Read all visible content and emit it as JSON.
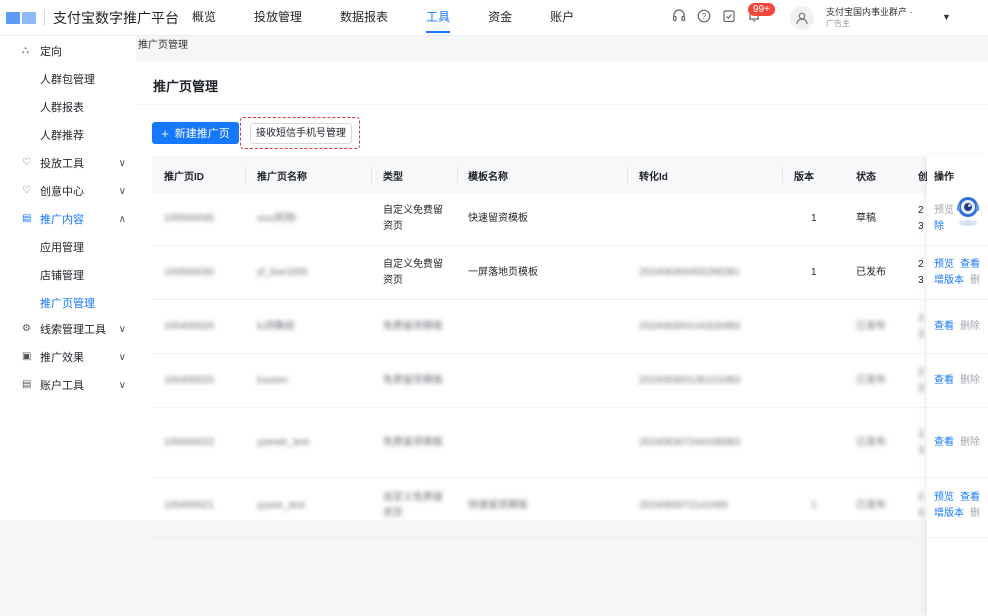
{
  "app": {
    "title": "支付宝数字推广平台"
  },
  "nav": [
    {
      "label": "概览",
      "active": false
    },
    {
      "label": "投放管理",
      "active": false
    },
    {
      "label": "数据报表",
      "active": false
    },
    {
      "label": "工具",
      "active": true
    },
    {
      "label": "资金",
      "active": false
    },
    {
      "label": "账户",
      "active": false
    }
  ],
  "topbar": {
    "icons": [
      "headset-icon",
      "help-icon",
      "todo-icon",
      "bell-icon"
    ],
    "badge": "99+",
    "user_name": "支付宝国内事业群产 ·",
    "user_role": "广告主"
  },
  "sidebar": {
    "items": [
      {
        "label": "定向",
        "icon": "target-icon",
        "type": "group",
        "expanded": true
      },
      {
        "label": "人群包管理",
        "type": "sub"
      },
      {
        "label": "人群报表",
        "type": "sub"
      },
      {
        "label": "人群推荐",
        "type": "sub"
      },
      {
        "label": "投放工具",
        "icon": "tool-icon",
        "type": "group",
        "expanded": false
      },
      {
        "label": "创意中心",
        "icon": "bulb-icon",
        "type": "group",
        "expanded": false
      },
      {
        "label": "推广内容",
        "icon": "content-icon",
        "type": "group",
        "expanded": true,
        "active": true
      },
      {
        "label": "应用管理",
        "type": "sub"
      },
      {
        "label": "店铺管理",
        "type": "sub"
      },
      {
        "label": "推广页管理",
        "type": "sub",
        "active": true
      },
      {
        "label": "线索管理工具",
        "icon": "clue-icon",
        "type": "group",
        "expanded": false
      },
      {
        "label": "推广效果",
        "icon": "effect-icon",
        "type": "group",
        "expanded": false
      },
      {
        "label": "账户工具",
        "icon": "account-icon",
        "type": "group",
        "expanded": false
      }
    ]
  },
  "breadcrumb": "推广页管理",
  "page": {
    "title": "推广页管理",
    "new_button": "新建推广页",
    "sms_button": "接收短信手机号管理"
  },
  "table": {
    "columns": [
      "推广页ID",
      "推广页名称",
      "类型",
      "模板名称",
      "转化Id",
      "版本",
      "状态",
      "创",
      "操作"
    ],
    "rows": [
      {
        "id": "100500045",
        "name": "uuu测测r",
        "type": "自定义免费留资页",
        "template": "快速留资模板",
        "conv": "",
        "version": "1",
        "status": "草稿",
        "created": "2 3",
        "ops": [
          "预览",
          "除"
        ]
      },
      {
        "id": "100500030",
        "name": "yf_live1655",
        "type": "自定义免费留资页",
        "template": "一屏落地页模板",
        "conv": "2024083004552982B1",
        "version": "1",
        "status": "已发布",
        "created": "2 3",
        "ops": [
          "预览",
          "查看",
          "增版本",
          "删"
        ]
      },
      {
        "id": "100400026",
        "name": "lu测集结",
        "type": "免费留资模板",
        "template": "",
        "conv": "2024083001443294B3",
        "version": "",
        "status": "已发布",
        "created": "2 3",
        "ops": [
          "查看",
          "删除"
        ]
      },
      {
        "id": "100400025",
        "name": "luuwev",
        "type": "免费留资模板",
        "template": "",
        "conv": "2024083001351010B3",
        "version": "",
        "status": "已发布",
        "created": "2 3",
        "ops": [
          "查看",
          "删除"
        ]
      },
      {
        "id": "100400022",
        "name": "yyiewe_test",
        "type": "免费留资模板",
        "template": "",
        "conv": "2024083072444386B3",
        "version": "",
        "status": "已发布",
        "created": "2 3",
        "ops": [
          "查看",
          "删除"
        ]
      },
      {
        "id": "100400021",
        "name": "yyyee_test",
        "type": "自定义免费留资页",
        "template": "快速留资模板",
        "conv": "2024083072142465",
        "version": "1",
        "status": "已发布",
        "created": "2 3",
        "ops": [
          "预览",
          "查看",
          "增版本",
          "删"
        ]
      }
    ]
  }
}
